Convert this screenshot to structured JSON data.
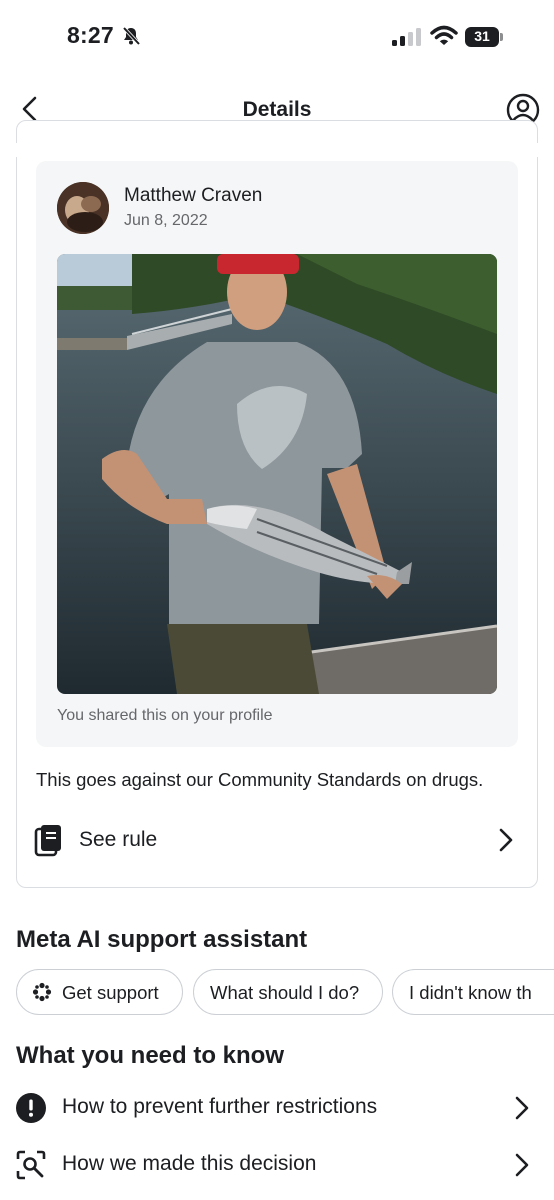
{
  "status_bar": {
    "time": "8:27",
    "battery": "31",
    "icons": [
      "bell-slash-icon",
      "signal-icon",
      "wifi-icon",
      "battery-icon"
    ]
  },
  "nav": {
    "title": "Details",
    "back_icon": "back-chevron-icon",
    "profile_icon": "person-circle-icon"
  },
  "post": {
    "author": "Matthew Craven",
    "date": "Jun 8, 2022",
    "shared_note": "You shared this on your profile"
  },
  "violation": {
    "text": "This goes against our Community Standards on drugs.",
    "see_rule_label": "See rule",
    "see_rule_icon": "book-icon"
  },
  "assistant": {
    "title": "Meta AI support assistant",
    "chips": [
      {
        "label": "Get support",
        "icon": "sparkle-icon"
      },
      {
        "label": "What should I do?"
      },
      {
        "label": "I didn't know th"
      }
    ]
  },
  "know": {
    "title": "What you need to know",
    "items": [
      {
        "label": "How to prevent further restrictions",
        "icon": "alert-circle-icon"
      },
      {
        "label": "How we made this decision",
        "icon": "scan-search-icon"
      }
    ]
  }
}
